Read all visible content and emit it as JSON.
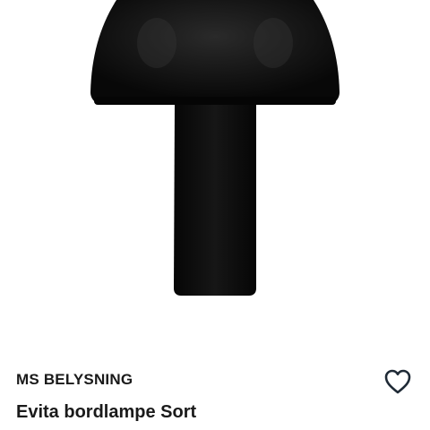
{
  "product": {
    "brand": "MS BELYSNING",
    "name": "Evita bordlampe Sort",
    "image_icon": "table-lamp-image",
    "favorite_icon": "heart-outline-icon"
  },
  "colors": {
    "lamp": "#0c0c0c",
    "text": "#1a1a1a",
    "icon": "#1f2a36",
    "background": "#ffffff"
  }
}
